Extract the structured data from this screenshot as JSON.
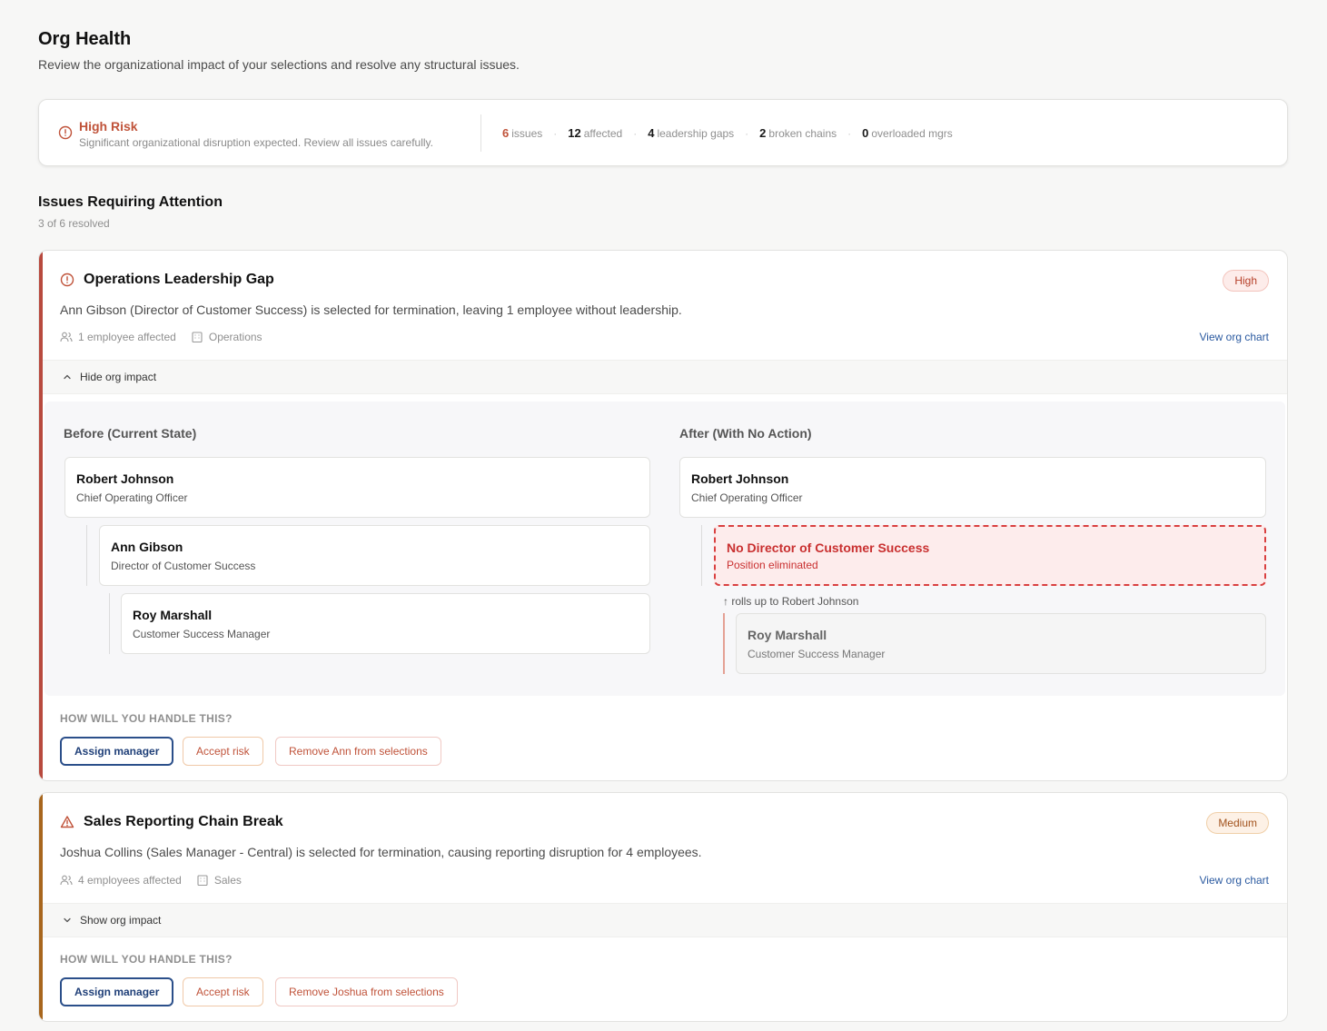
{
  "header": {
    "title": "Org Health",
    "subtitle": "Review the organizational impact of your selections and resolve any structural issues."
  },
  "risk": {
    "title": "High Risk",
    "description": "Significant organizational disruption expected. Review all issues carefully.",
    "stats": [
      {
        "value": "6",
        "label": "issues"
      },
      {
        "value": "12",
        "label": "affected"
      },
      {
        "value": "4",
        "label": "leadership gaps"
      },
      {
        "value": "2",
        "label": "broken chains"
      },
      {
        "value": "0",
        "label": "overloaded mgrs"
      }
    ]
  },
  "issues_section": {
    "title": "Issues Requiring Attention",
    "subtitle": "3 of 6 resolved"
  },
  "issues": [
    {
      "title": "Operations Leadership Gap",
      "severity": "High",
      "description": "Ann Gibson (Director of Customer Success) is selected for termination, leaving 1 employee without leadership.",
      "affected": "1 employee affected",
      "department": "Operations",
      "view_link": "View org chart",
      "toggle_label": "Hide org impact",
      "before": {
        "heading": "Before (Current State)",
        "nodes": [
          {
            "name": "Robert Johnson",
            "role": "Chief Operating Officer"
          },
          {
            "name": "Ann Gibson",
            "role": "Director of Customer Success"
          },
          {
            "name": "Roy Marshall",
            "role": "Customer Success Manager"
          }
        ]
      },
      "after": {
        "heading": "After (With No Action)",
        "top": {
          "name": "Robert Johnson",
          "role": "Chief Operating Officer"
        },
        "gap": {
          "name": "No Director of Customer Success",
          "role": "Position eliminated"
        },
        "rollup": "↑ rolls up to Robert Johnson",
        "orphan": {
          "name": "Roy Marshall",
          "role": "Customer Success Manager"
        }
      },
      "handle_label": "HOW WILL YOU HANDLE THIS?",
      "actions": {
        "assign": "Assign manager",
        "accept": "Accept risk",
        "remove": "Remove Ann from selections"
      }
    },
    {
      "title": "Sales Reporting Chain Break",
      "severity": "Medium",
      "description": "Joshua Collins (Sales Manager - Central) is selected for termination, causing reporting disruption for 4 employees.",
      "affected": "4 employees affected",
      "department": "Sales",
      "view_link": "View org chart",
      "toggle_label": "Show org impact",
      "handle_label": "HOW WILL YOU HANDLE THIS?",
      "actions": {
        "assign": "Assign manager",
        "accept": "Accept risk",
        "remove": "Remove Joshua from selections"
      }
    }
  ],
  "colors": {
    "high_accent": "#b84a3e",
    "medium_accent": "#a8661d",
    "link": "#2b5aa0",
    "danger": "#d94040"
  }
}
